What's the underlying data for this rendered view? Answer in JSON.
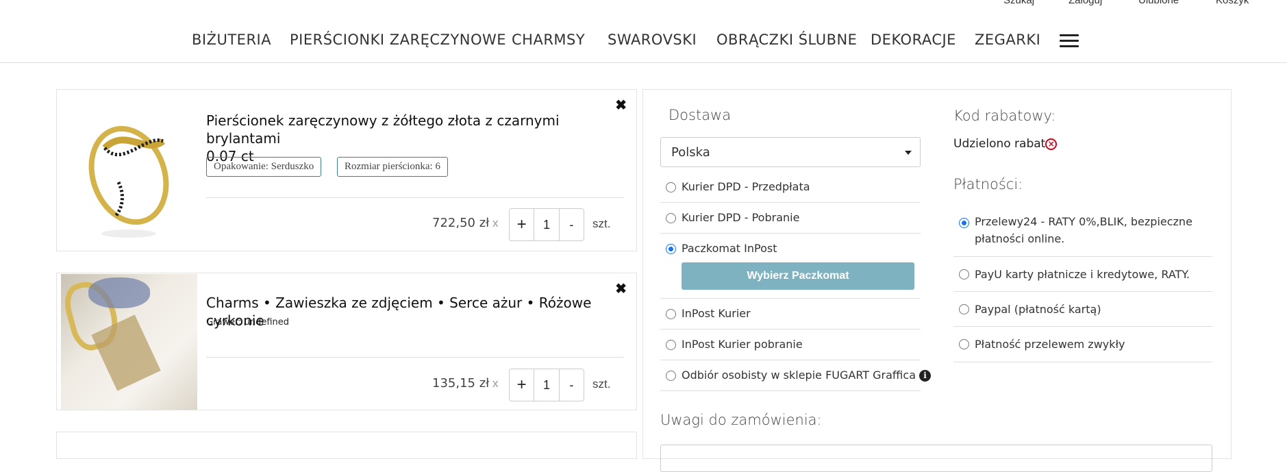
{
  "topbar": {
    "search": "Szukaj",
    "login": "Zaloguj",
    "favorites": "Ulubione",
    "cart": "Koszyk"
  },
  "nav": [
    "BIŻUTERIA",
    "PIERŚCIONKI ZARĘCZYNOWE",
    "CHARMSY",
    "SWAROVSKI",
    "OBRĄCZKI ŚLUBNE",
    "DEKORACJE",
    "ZEGARKI"
  ],
  "cart": [
    {
      "title_line1": "Pierścionek zaręczynowy z żółtego złota z czarnymi brylantami",
      "title_line2": "0.07 ct",
      "tags": [
        "Opakowanie: Serduszko",
        "Rozmiar pierścionka: 6"
      ],
      "price": "722,50 zł",
      "times": "x",
      "qty": "1",
      "plus": "+",
      "minus": "-",
      "unit": "szt."
    },
    {
      "title_line1": "Charms • Zawieszka ze zdjęciem • Serce ażur • Różowe cyrkonie",
      "engraving": "Grawer: undefined",
      "price": "135,15 zł",
      "times": "x",
      "qty": "1",
      "plus": "+",
      "minus": "-",
      "unit": "szt."
    }
  ],
  "shipping": {
    "title": "Dostawa",
    "country": "Polska",
    "options": [
      {
        "label": "Kurier DPD - Przedpłata",
        "selected": false
      },
      {
        "label": "Kurier DPD - Pobranie",
        "selected": false
      },
      {
        "label": "Paczkomat InPost",
        "selected": true
      },
      {
        "label": "InPost Kurier",
        "selected": false
      },
      {
        "label": "InPost Kurier pobranie",
        "selected": false
      },
      {
        "label": "Odbiór osobisty w sklepie FUGART Graffica",
        "selected": false
      }
    ],
    "paczkomat_button": "Wybierz Paczkomat"
  },
  "discount": {
    "title": "Kod rabatowy:",
    "status": "Udzielono rabat"
  },
  "payment": {
    "title": "Płatności:",
    "options": [
      {
        "line1": "Przelewy24 - RATY 0%,BLIK, bezpieczne",
        "line2": "płatności online.",
        "selected": true
      },
      {
        "line1": "PayU karty płatnicze i kredytowe, RATY.",
        "selected": false
      },
      {
        "line1": "Paypal (płatność kartą)",
        "selected": false
      },
      {
        "line1": "Płatność przelewem zwykły",
        "selected": false
      }
    ]
  },
  "notes": {
    "title": "Uwagi do zamówienia:"
  },
  "icons": {
    "close": "close-icon",
    "menu": "hamburger-menu-icon",
    "info": "info-icon",
    "remove_discount": "remove-discount-icon"
  }
}
